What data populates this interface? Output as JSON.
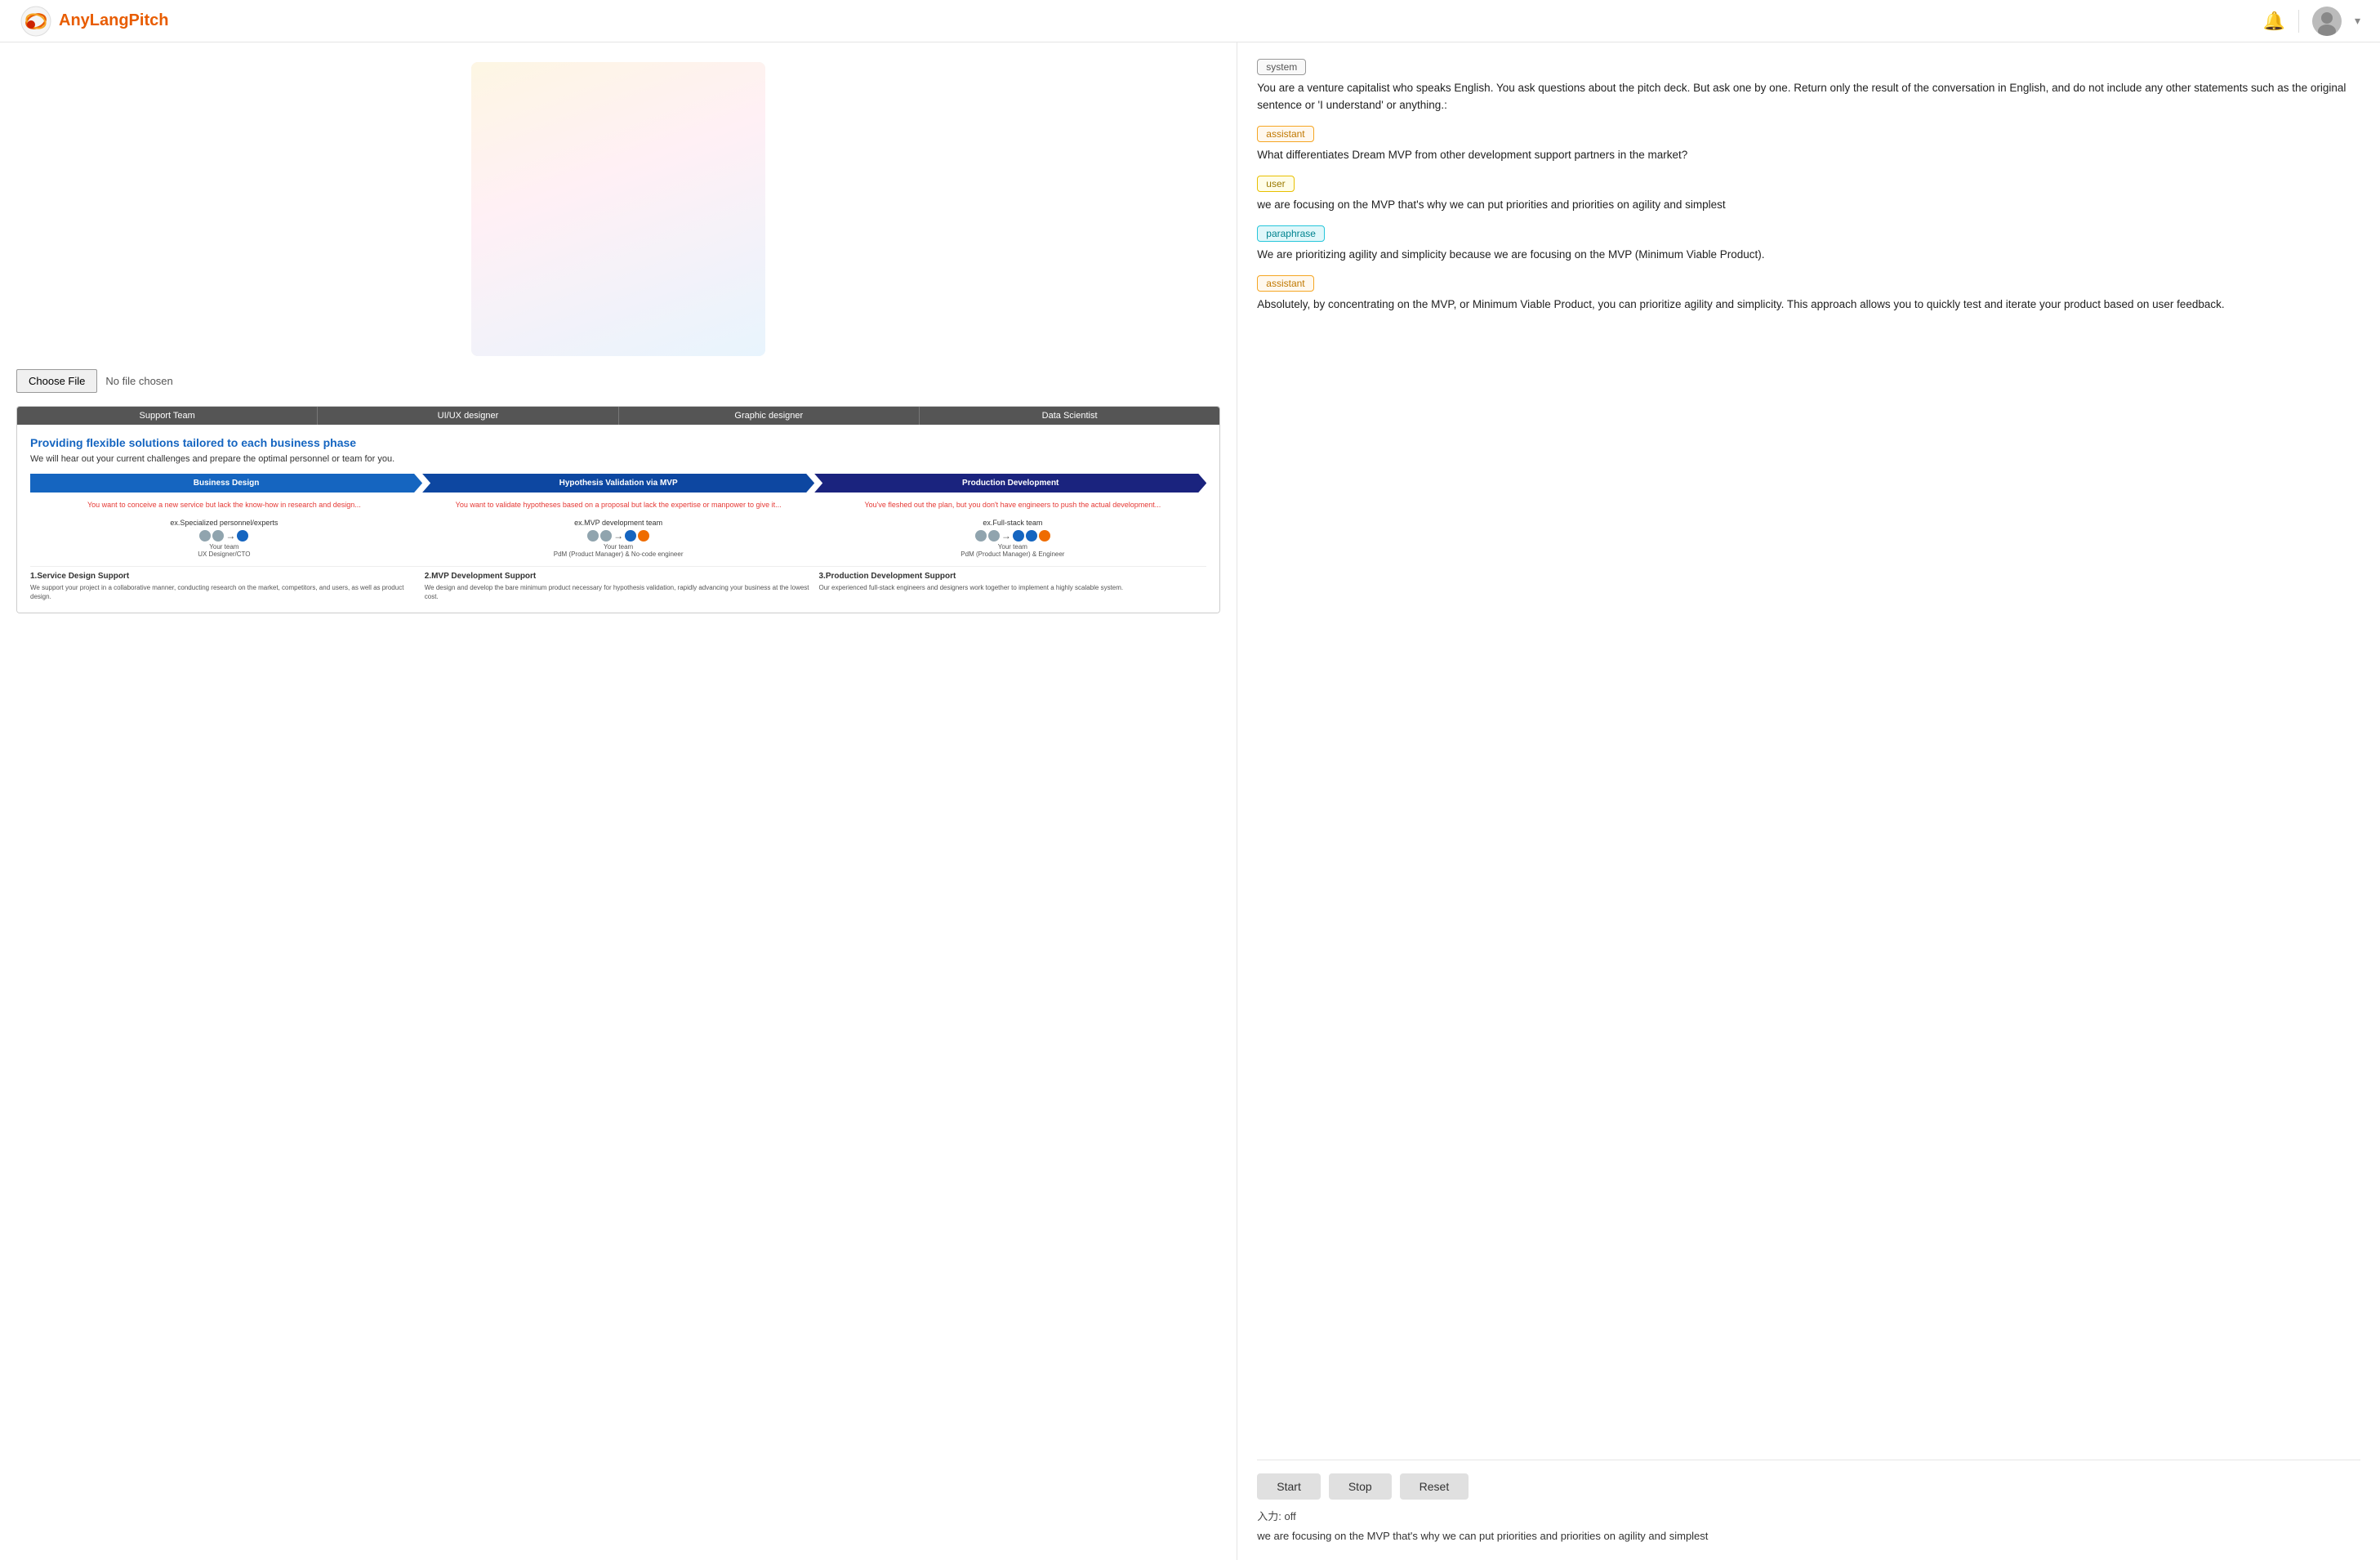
{
  "app": {
    "name": "AnyLangPitch",
    "logo_alt": "AnyLangPitch Logo"
  },
  "header": {
    "bell_label": "🔔",
    "avatar_label": "👤",
    "chevron_label": "▾"
  },
  "left_panel": {
    "file_input": {
      "choose_btn": "Choose File",
      "file_name": "No file chosen"
    },
    "slide": {
      "header_cells": [
        "Support Team",
        "UI/UX designer",
        "Graphic designer",
        "Data Scientist"
      ],
      "title": "Providing flexible solutions tailored to each business phase",
      "subtitle": "We will hear out your current challenges and prepare the optimal personnel or team for you.",
      "phases": [
        {
          "label": "Business Design",
          "color": "phase-blue"
        },
        {
          "label": "Hypothesis Validation via MVP",
          "color": "phase-dark-blue"
        },
        {
          "label": "Production Development",
          "color": "phase-navy"
        }
      ],
      "phase_descs": [
        "You want to conceive a new service but lack the know-how in research and design...",
        "You want to validate hypotheses based on a proposal but lack the expertise or manpower to give it...",
        "You've fleshed out the plan, but you don't have engineers to push the actual development..."
      ],
      "examples": [
        {
          "label": "ex.Specialized personnel/experts",
          "team_label": "Your team",
          "expert_label": "UX Designer/CTO"
        },
        {
          "label": "ex.MVP development team",
          "team_label": "Your team",
          "expert_label": "PdM (Product Manager) & No-code engineer"
        },
        {
          "label": "ex.Full-stack team",
          "team_label": "Your team",
          "expert_label": "PdM (Product Manager) & Engineer"
        }
      ],
      "support_cards": [
        {
          "title": "1.Service Design Support",
          "text": "We support your project in a collaborative manner, conducting research on the market, competitors, and users, as well as product design."
        },
        {
          "title": "2.MVP Development Support",
          "text": "We design and develop the bare minimum product necessary for hypothesis validation, rapidly advancing your business at the lowest cost."
        },
        {
          "title": "3.Production Development Support",
          "text": "Our experienced full-stack engineers and designers work together to implement a highly scalable system."
        }
      ]
    }
  },
  "right_panel": {
    "messages": [
      {
        "role": "system",
        "role_badge": "system",
        "badge_class": "system",
        "text": "You are a venture capitalist who speaks English. You ask questions about the pitch deck. But ask one by one. Return only the result of the conversation in English, and do not include any other statements such as the original sentence or 'I understand' or anything.:"
      },
      {
        "role": "assistant",
        "role_badge": "assistant",
        "badge_class": "assistant",
        "text": "What differentiates Dream MVP from other development support partners in the market?"
      },
      {
        "role": "user",
        "role_badge": "user",
        "badge_class": "user",
        "text": "we are focusing on the MVP that's why we can put priorities and priorities on agility and simplest"
      },
      {
        "role": "paraphrase",
        "role_badge": "paraphrase",
        "badge_class": "paraphrase",
        "text": "We are prioritizing agility and simplicity because we are focusing on the MVP (Minimum Viable Product)."
      },
      {
        "role": "assistant",
        "role_badge": "assistant",
        "badge_class": "assistant",
        "text": "Absolutely, by concentrating on the MVP, or Minimum Viable Product, you can prioritize agility and simplicity. This approach allows you to quickly test and iterate your product based on user feedback."
      }
    ],
    "controls": {
      "start_btn": "Start",
      "stop_btn": "Stop",
      "reset_btn": "Reset",
      "input_status_label": "入力:",
      "input_status_value": "off",
      "transcript": "we are focusing on the MVP that's why we can put priorities and priorities on agility and simplest"
    }
  }
}
